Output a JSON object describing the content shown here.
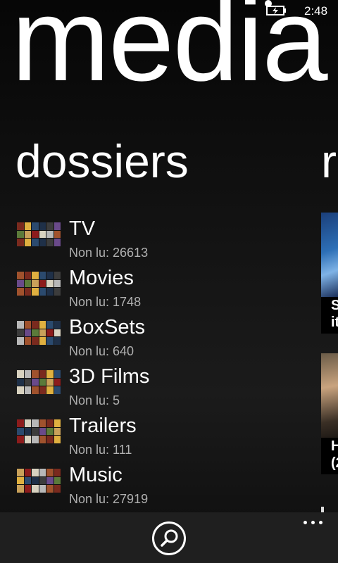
{
  "status_bar": {
    "time": "2:48",
    "icons": [
      "notification-dot-icon",
      "battery-charging-icon"
    ]
  },
  "app": {
    "title": "media"
  },
  "pivot": {
    "current_section": "dossiers",
    "next_section_peek": "r"
  },
  "folders": [
    {
      "name": "TV",
      "unread": "Non lu: 26613",
      "thumb_icon": "tv-collage-icon"
    },
    {
      "name": "Movies",
      "unread": "Non lu: 1748",
      "thumb_icon": "movies-collage-icon"
    },
    {
      "name": "BoxSets",
      "unread": "Non lu: 640",
      "thumb_icon": "boxsets-collage-icon"
    },
    {
      "name": "3D Films",
      "unread": "Non lu: 5",
      "thumb_icon": "3d-films-collage-icon"
    },
    {
      "name": "Trailers",
      "unread": "Non lu: 111",
      "thumb_icon": "trailers-collage-icon"
    },
    {
      "name": "Music",
      "unread": "Non lu: 27919",
      "thumb_icon": "music-collage-icon"
    }
  ],
  "recent_peek": [
    {
      "caption_line1": "S",
      "caption_line2": "it"
    },
    {
      "caption_line1": "H",
      "caption_line2": "(2"
    }
  ],
  "app_bar": {
    "search_icon": "search-icon",
    "more_icon": "more-ellipsis-icon"
  },
  "colors": {
    "background": "#111111",
    "foreground": "#ffffff",
    "subtle_text": "#b0b0b0",
    "app_bar": "#1f1f1f",
    "peek_blue": "#2d6fb6"
  }
}
